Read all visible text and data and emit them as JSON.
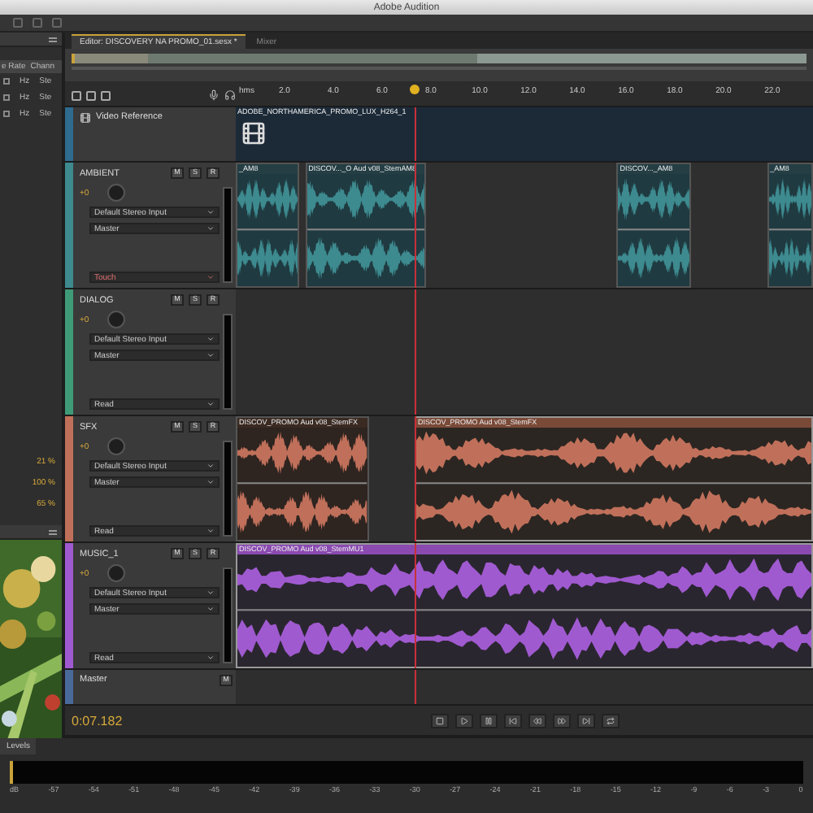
{
  "window": {
    "title": "Adobe Audition"
  },
  "files_panel": {
    "columns": [
      "e Rate",
      "Chann"
    ],
    "rows": [
      {
        "checked": false,
        "column_1": "Hz",
        "column_2": "Ste"
      },
      {
        "checked": false,
        "column_1": "Hz",
        "column_2": "Ste"
      },
      {
        "checked": false,
        "column_1": "Hz",
        "column_2": "Ste"
      }
    ],
    "percentages": [
      "21 %",
      "100 %",
      "65 %"
    ]
  },
  "editor_tabs": [
    {
      "label": "Editor: DISCOVERY NA PROMO_01.sesx *",
      "selected": true
    },
    {
      "label": "Mixer",
      "selected": false
    }
  ],
  "ruler": {
    "unit": "hms",
    "ticks": [
      "2.0",
      "4.0",
      "6.0",
      "8.0",
      "10.0",
      "12.0",
      "14.0",
      "16.0",
      "18.0",
      "20.0",
      "22.0"
    ]
  },
  "video_track": {
    "name": "Video Reference",
    "clip": "ADOBE_NORTHAMERICA_PROMO_LUX_H264_1"
  },
  "tracks": [
    {
      "name": "AMBIENT",
      "color": "#3d8a8f",
      "volume": "+0",
      "buttons": [
        "M",
        "S",
        "R"
      ],
      "input": "Default Stereo Input",
      "output": "Master",
      "mode": "Touch",
      "armed_mode": true,
      "clips": [
        {
          "label": "_AM8",
          "selected": false
        },
        {
          "label": "DISCOV..._O Aud v08_StemAM8",
          "selected": false
        },
        {
          "label": "DISCOV..._AM8",
          "selected": false
        },
        {
          "label": "_AM8",
          "selected": false
        }
      ]
    },
    {
      "name": "DIALOG",
      "color": "#3f9a78",
      "volume": "+0",
      "buttons": [
        "M",
        "S",
        "R"
      ],
      "input": "Default Stereo Input",
      "output": "Master",
      "mode": "Read",
      "armed_mode": false
    },
    {
      "name": "SFX",
      "color": "#c0705a",
      "volume": "+0",
      "buttons": [
        "M",
        "S",
        "R"
      ],
      "input": "Default Stereo Input",
      "output": "Master",
      "mode": "Read",
      "armed_mode": false,
      "clips": [
        {
          "label": "DISCOV_PROMO Aud v08_StemFX",
          "selected": false
        },
        {
          "label": "DISCOV_PROMO Aud v08_StemFX",
          "selected": true
        }
      ]
    },
    {
      "name": "MUSIC_1",
      "color": "#a05ad0",
      "volume": "+0",
      "buttons": [
        "M",
        "S",
        "R"
      ],
      "input": "Default Stereo Input",
      "output": "Master",
      "mode": "Read",
      "armed_mode": false,
      "clips": [
        {
          "label": "DISCOV_PROMO Aud v08_StemMU1",
          "selected": true
        }
      ]
    }
  ],
  "master_track": {
    "name": "Master",
    "buttons": [
      "M"
    ]
  },
  "time": "0:07.182",
  "levels": {
    "title": "Levels",
    "scale": [
      "dB",
      "-57",
      "-54",
      "-51",
      "-48",
      "-45",
      "-42",
      "-39",
      "-36",
      "-33",
      "-30",
      "-27",
      "-24",
      "-21",
      "-18",
      "-15",
      "-12",
      "-9",
      "-6",
      "-3",
      "0"
    ]
  }
}
